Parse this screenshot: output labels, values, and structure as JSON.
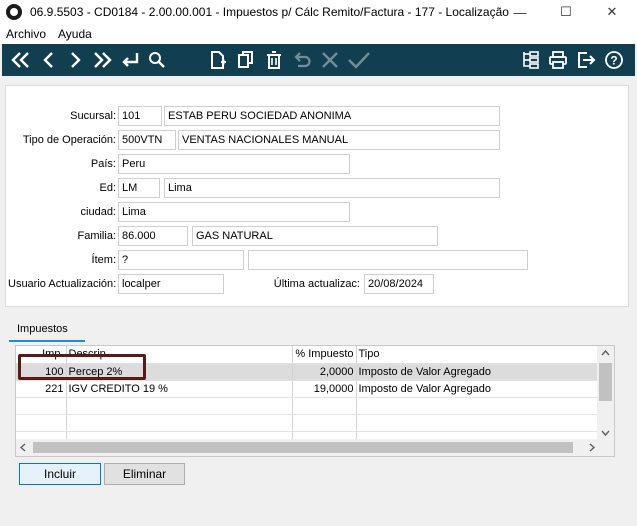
{
  "window": {
    "title": "06.9.5503 - CD0184 - 2.00.00.001 - Impuestos p/ Cálc Remito/Factura - 177 - Localização ...",
    "minimize": "—",
    "maximize": "☐",
    "close": "✕"
  },
  "menu": {
    "items": [
      "Archivo",
      "Ayuda"
    ]
  },
  "form": {
    "sucursal": {
      "label": "Sucursal:",
      "code": "101",
      "desc": "ESTAB PERU SOCIEDAD ANONIMA"
    },
    "tipo_operacion": {
      "label": "Tipo de Operación:",
      "code": "500VTN",
      "desc": "VENTAS NACIONALES MANUAL"
    },
    "pais": {
      "label": "País:",
      "value": "Peru"
    },
    "ed": {
      "label": "Ed:",
      "code": "LM",
      "desc": "Lima"
    },
    "ciudad": {
      "label": "ciudad:",
      "value": "Lima"
    },
    "familia": {
      "label": "Familia:",
      "code": "86.000",
      "desc": "GAS NATURAL"
    },
    "item": {
      "label": "Ítem:",
      "code": "?",
      "desc": ""
    },
    "usuario": {
      "label": "Usuario Actualización:",
      "value": "localper"
    },
    "ultima": {
      "label": "Última actualizac:",
      "value": "20/08/2024"
    }
  },
  "tabs": {
    "impuestos": "Impuestos"
  },
  "grid": {
    "headers": {
      "imp": "Imp.",
      "descrip": "Descrip.",
      "pct": "% Impuesto",
      "tipo": "Tipo"
    },
    "rows": [
      {
        "imp": "100",
        "descrip": "Percep 2%",
        "pct": "2,0000",
        "tipo": "Imposto de Valor Agregado"
      },
      {
        "imp": "221",
        "descrip": "IGV CREDITO 19 %",
        "pct": "19,0000",
        "tipo": "Imposto de Valor Agregado"
      }
    ]
  },
  "buttons": {
    "incluir": "Incluir",
    "eliminar": "Eliminar"
  }
}
